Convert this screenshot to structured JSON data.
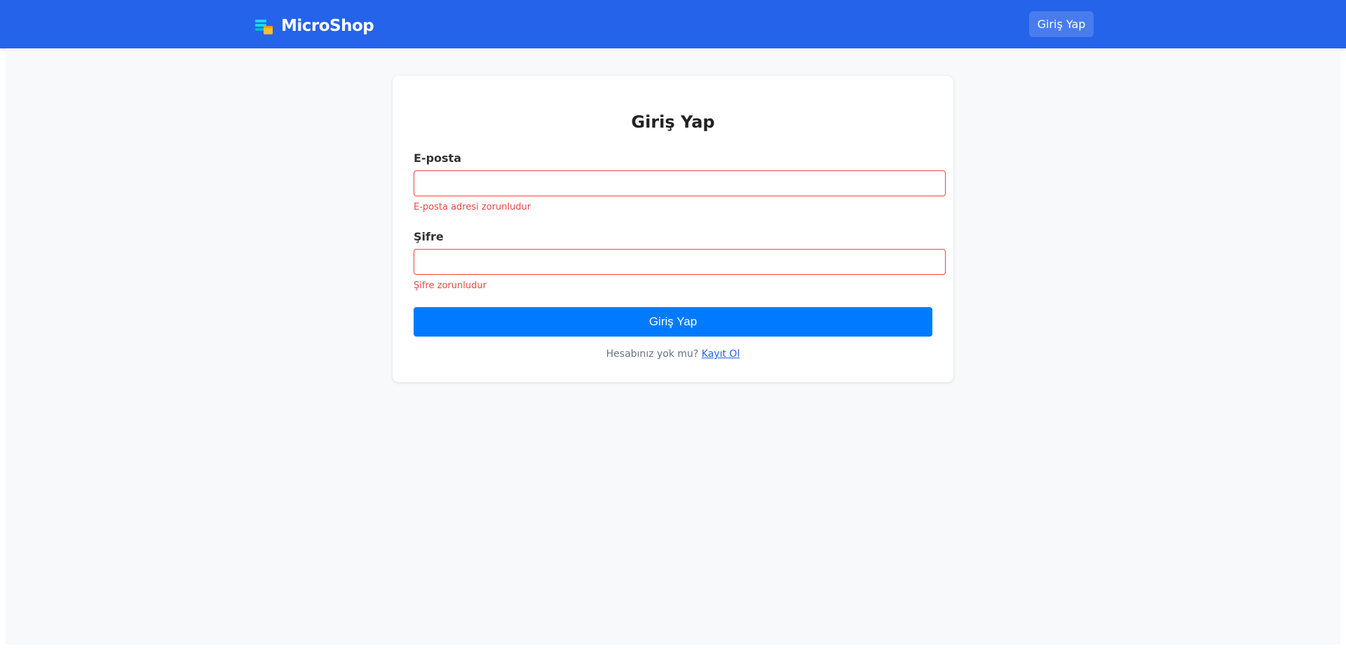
{
  "header": {
    "brand_name": "MicroShop",
    "brand_icon": "stacked-boxes-icon",
    "login_label": "Giriş Yap",
    "background_color": "#2563eb"
  },
  "login_form": {
    "title": "Giriş Yap",
    "email": {
      "label": "E-posta",
      "value": "",
      "error": "E-posta adresi zorunludur"
    },
    "password": {
      "label": "Şifre",
      "value": "",
      "error": "Şifre zorunludur"
    },
    "submit_label": "Giriş Yap",
    "register_prompt": "Hesabınız yok mu?",
    "register_link": "Kayıt Ol"
  },
  "colors": {
    "primary_button": "#007bff",
    "error": "#ef4444",
    "page_background": "#f8f9fb"
  }
}
